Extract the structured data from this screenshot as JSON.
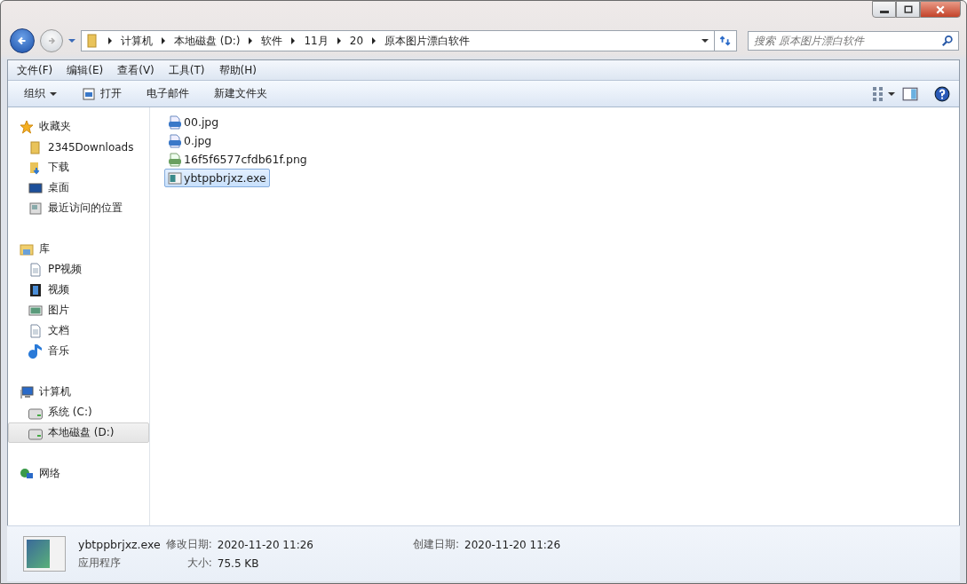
{
  "breadcrumb": [
    "计算机",
    "本地磁盘 (D:)",
    "软件",
    "11月",
    "20",
    "原本图片漂白软件"
  ],
  "search": {
    "placeholder": "搜索 原本图片漂白软件"
  },
  "menu": [
    "文件(F)",
    "编辑(E)",
    "查看(V)",
    "工具(T)",
    "帮助(H)"
  ],
  "toolbar": [
    {
      "label": "组织",
      "kind": "dropdown"
    },
    {
      "label": "打开",
      "kind": "open"
    },
    {
      "label": "电子邮件",
      "kind": "plain"
    },
    {
      "label": "新建文件夹",
      "kind": "plain"
    }
  ],
  "sidebar": [
    {
      "label": "收藏夹",
      "kind": "star",
      "children": [
        {
          "label": "2345Downloads",
          "kind": "folder",
          "selected": false
        },
        {
          "label": "下载",
          "kind": "download",
          "selected": false
        },
        {
          "label": "桌面",
          "kind": "desktop",
          "selected": false
        },
        {
          "label": "最近访问的位置",
          "kind": "recent",
          "selected": false
        }
      ]
    },
    {
      "label": "库",
      "kind": "library",
      "children": [
        {
          "label": "PP视频",
          "kind": "doc",
          "selected": false
        },
        {
          "label": "视频",
          "kind": "film",
          "selected": false
        },
        {
          "label": "图片",
          "kind": "picture",
          "selected": false
        },
        {
          "label": "文档",
          "kind": "doc",
          "selected": false
        },
        {
          "label": "音乐",
          "kind": "music",
          "selected": false
        }
      ]
    },
    {
      "label": "计算机",
      "kind": "computer",
      "children": [
        {
          "label": "系统 (C:)",
          "kind": "drive",
          "selected": false
        },
        {
          "label": "本地磁盘 (D:)",
          "kind": "drive",
          "selected": true
        }
      ]
    },
    {
      "label": "网络",
      "kind": "network"
    }
  ],
  "files": [
    {
      "name": "00.jpg",
      "kind": "jpg",
      "selected": false
    },
    {
      "name": "0.jpg",
      "kind": "jpg",
      "selected": false
    },
    {
      "name": "16f5f6577cfdb61f.png",
      "kind": "png",
      "selected": false
    },
    {
      "name": "ybtppbrjxz.exe",
      "kind": "exe",
      "selected": true
    }
  ],
  "details": {
    "name": "ybtppbrjxz.exe",
    "type": "应用程序",
    "modified_label": "修改日期:",
    "modified": "2020-11-20 11:26",
    "created_label": "创建日期:",
    "created": "2020-11-20 11:26",
    "size_label": "大小:",
    "size": "75.5 KB"
  }
}
